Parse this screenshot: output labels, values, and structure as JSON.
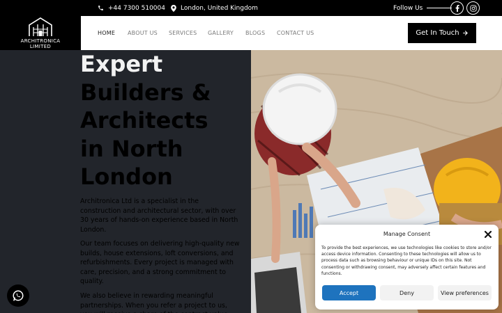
{
  "topbar": {
    "phone": "+44 7300 510004",
    "location": "London, United Kingdom",
    "follow_label": "Follow Us",
    "icons": [
      "phone-icon",
      "map-pin-icon",
      "facebook-icon",
      "instagram-icon"
    ]
  },
  "logo": {
    "name": "ARCHITRONICA",
    "sub": "LIMITED"
  },
  "nav": {
    "items": [
      {
        "label": "HOME"
      },
      {
        "label": "ABOUT US"
      },
      {
        "label": "SERVICES"
      },
      {
        "label": "GALLERY"
      },
      {
        "label": "BLOGS"
      },
      {
        "label": "CONTACT US"
      }
    ],
    "cta": "Get In Touch"
  },
  "hero": {
    "headline": [
      "Expert",
      "Builders &",
      "Architects",
      "in North",
      "London"
    ],
    "paragraphs": [
      "Architronica Ltd is a specialist in the construction and architectural sector, with over 30 years of hands-on experience based in North London.",
      "Our team focuses on delivering high-quality new builds, house extensions, loft conversions, and refurbishments. Every project is managed with care, precision, and a strong commitment to quality.",
      "We also believe in rewarding meaningful partnerships. When you refer a project to us, you will receive a share of the contract value."
    ]
  },
  "consent": {
    "title": "Manage Consent",
    "body": "To provide the best experiences, we use technologies like cookies to store and/or access device information. Consenting to these technologies will allow us to process data such as browsing behaviour or unique IDs on this site. Not consenting or withdrawing consent, may adversely affect certain features and functions.",
    "accept": "Accept",
    "deny": "Deny",
    "preferences": "View preferences"
  },
  "colors": {
    "topbar": "#000000",
    "hero_panel": "#22252b",
    "accept_button": "#1e73be"
  }
}
